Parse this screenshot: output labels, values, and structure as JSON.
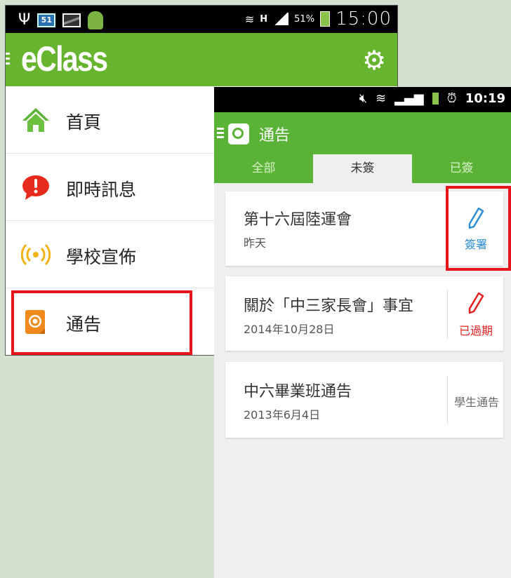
{
  "drawer_screen": {
    "status_bar": {
      "badge": "51",
      "battery": "51%",
      "time": "15:00"
    },
    "app_logo": "eClass",
    "menu": [
      {
        "label": "首頁",
        "icon": "home-icon"
      },
      {
        "label": "即時訊息",
        "icon": "alert-message-icon"
      },
      {
        "label": "學校宣佈",
        "icon": "broadcast-icon"
      },
      {
        "label": "通告",
        "icon": "notice-icon"
      }
    ]
  },
  "notice_screen": {
    "status_bar": {
      "time": "10:19"
    },
    "title": "通告",
    "tabs": [
      "全部",
      "未簽",
      "已簽"
    ],
    "notices": [
      {
        "title": "第十六屆陸運會",
        "date": "昨天",
        "status": "簽署",
        "status_color": "#2a8fd4"
      },
      {
        "title": "關於「中三家長會」事宜",
        "date": "2014年10月28日",
        "status": "已過期",
        "status_color": "#e02020"
      },
      {
        "title": "中六畢業班通告",
        "date": "2013年6月4日",
        "status": "學生通告",
        "status_color": "#666666"
      }
    ]
  },
  "colors": {
    "brand_green": "#67b52e",
    "highlight_red": "#e8141b"
  }
}
